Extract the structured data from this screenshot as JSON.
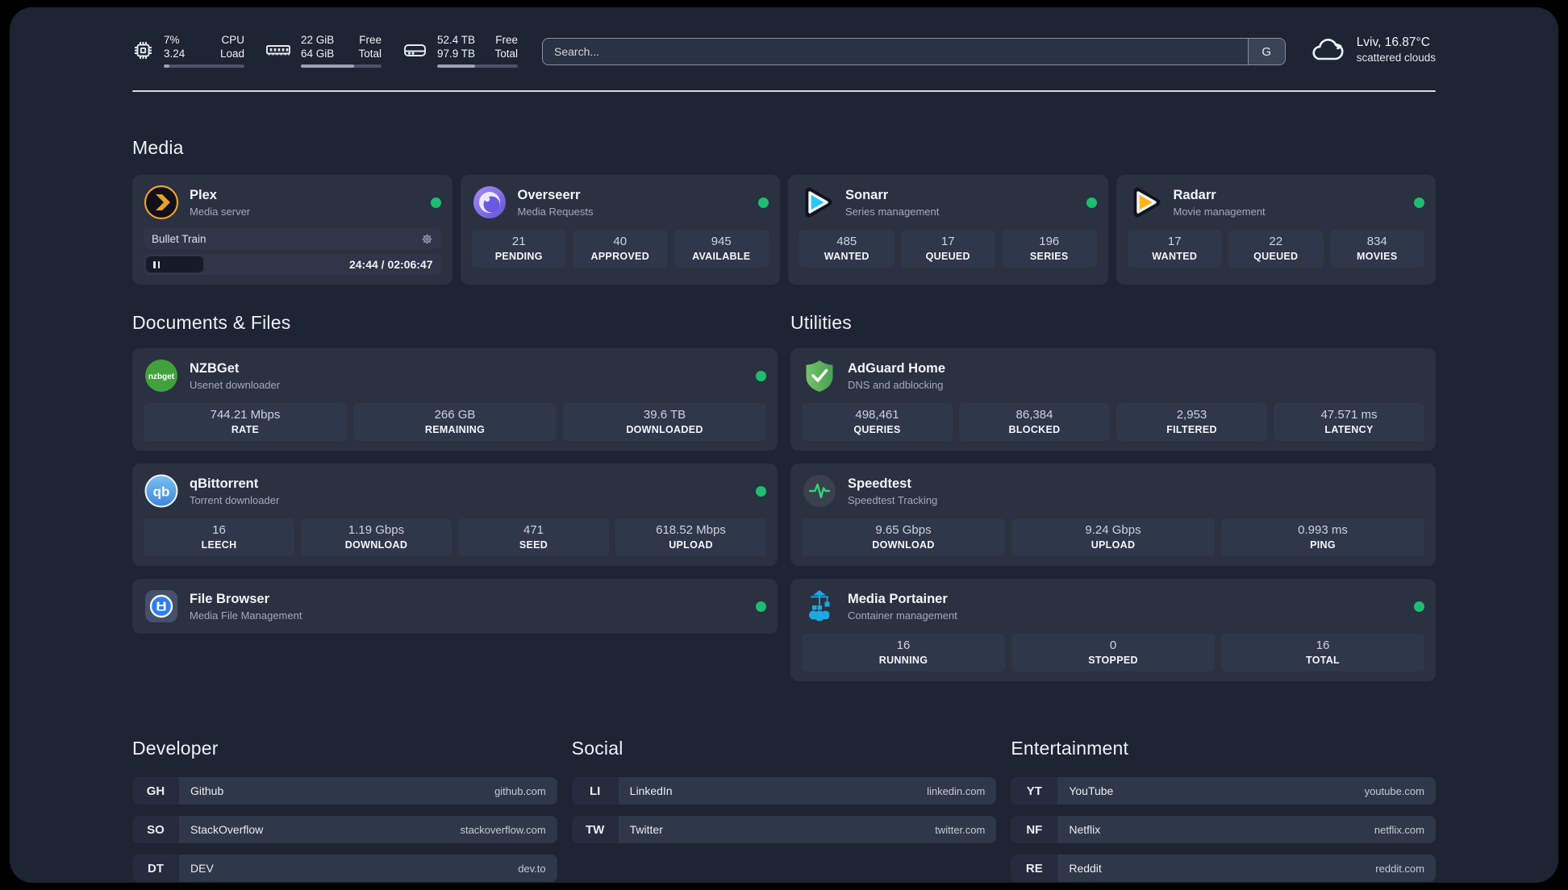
{
  "header": {
    "cpu": {
      "v1": "7%",
      "v2": "3.24",
      "l1": "CPU",
      "l2": "Load",
      "progress": 7
    },
    "ram": {
      "v1": "22 GiB",
      "v2": "64 GiB",
      "l1": "Free",
      "l2": "Total",
      "progress": 66
    },
    "disk": {
      "v1": "52.4 TB",
      "v2": "97.9 TB",
      "l1": "Free",
      "l2": "Total",
      "progress": 47
    },
    "search": {
      "placeholder": "Search...",
      "button": "G"
    },
    "weather": {
      "title": "Lviv, 16.87°C",
      "subtitle": "scattered clouds"
    }
  },
  "media": {
    "title": "Media",
    "plex": {
      "name": "Plex",
      "desc": "Media server",
      "now_playing": "Bullet Train",
      "time": "24:44 / 02:06:47",
      "progress": 20
    },
    "overseerr": {
      "name": "Overseerr",
      "desc": "Media Requests",
      "stats": [
        {
          "value": "21",
          "label": "PENDING"
        },
        {
          "value": "40",
          "label": "APPROVED"
        },
        {
          "value": "945",
          "label": "AVAILABLE"
        }
      ]
    },
    "sonarr": {
      "name": "Sonarr",
      "desc": "Series management",
      "stats": [
        {
          "value": "485",
          "label": "WANTED"
        },
        {
          "value": "17",
          "label": "QUEUED"
        },
        {
          "value": "196",
          "label": "SERIES"
        }
      ]
    },
    "radarr": {
      "name": "Radarr",
      "desc": "Movie management",
      "stats": [
        {
          "value": "17",
          "label": "WANTED"
        },
        {
          "value": "22",
          "label": "QUEUED"
        },
        {
          "value": "834",
          "label": "MOVIES"
        }
      ]
    }
  },
  "documents": {
    "title": "Documents & Files",
    "nzbget": {
      "name": "NZBGet",
      "desc": "Usenet downloader",
      "stats": [
        {
          "value": "744.21 Mbps",
          "label": "RATE"
        },
        {
          "value": "266 GB",
          "label": "REMAINING"
        },
        {
          "value": "39.6 TB",
          "label": "DOWNLOADED"
        }
      ]
    },
    "qbittorrent": {
      "name": "qBittorrent",
      "desc": "Torrent downloader",
      "stats": [
        {
          "value": "16",
          "label": "LEECH"
        },
        {
          "value": "1.19 Gbps",
          "label": "DOWNLOAD"
        },
        {
          "value": "471",
          "label": "SEED"
        },
        {
          "value": "618.52 Mbps",
          "label": "UPLOAD"
        }
      ]
    },
    "filebrowser": {
      "name": "File Browser",
      "desc": "Media File Management"
    }
  },
  "utilities": {
    "title": "Utilities",
    "adguard": {
      "name": "AdGuard Home",
      "desc": "DNS and adblocking",
      "stats": [
        {
          "value": "498,461",
          "label": "QUERIES"
        },
        {
          "value": "86,384",
          "label": "BLOCKED"
        },
        {
          "value": "2,953",
          "label": "FILTERED"
        },
        {
          "value": "47.571 ms",
          "label": "LATENCY"
        }
      ]
    },
    "speedtest": {
      "name": "Speedtest",
      "desc": "Speedtest Tracking",
      "stats": [
        {
          "value": "9.65 Gbps",
          "label": "DOWNLOAD"
        },
        {
          "value": "9.24 Gbps",
          "label": "UPLOAD"
        },
        {
          "value": "0.993 ms",
          "label": "PING"
        }
      ]
    },
    "portainer": {
      "name": "Media Portainer",
      "desc": "Container management",
      "stats": [
        {
          "value": "16",
          "label": "RUNNING"
        },
        {
          "value": "0",
          "label": "STOPPED"
        },
        {
          "value": "16",
          "label": "TOTAL"
        }
      ]
    }
  },
  "links": {
    "developer": {
      "title": "Developer",
      "items": [
        {
          "tag": "GH",
          "name": "Github",
          "url": "github.com"
        },
        {
          "tag": "SO",
          "name": "StackOverflow",
          "url": "stackoverflow.com"
        },
        {
          "tag": "DT",
          "name": "DEV",
          "url": "dev.to"
        }
      ]
    },
    "social": {
      "title": "Social",
      "items": [
        {
          "tag": "LI",
          "name": "LinkedIn",
          "url": "linkedin.com"
        },
        {
          "tag": "TW",
          "name": "Twitter",
          "url": "twitter.com"
        }
      ]
    },
    "entertainment": {
      "title": "Entertainment",
      "items": [
        {
          "tag": "YT",
          "name": "YouTube",
          "url": "youtube.com"
        },
        {
          "tag": "NF",
          "name": "Netflix",
          "url": "netflix.com"
        },
        {
          "tag": "RE",
          "name": "Reddit",
          "url": "reddit.com"
        }
      ]
    }
  },
  "colors": {
    "status_online": "#1ebd71",
    "plex_accent": "#e8a12b",
    "sonarr_accent": "#2bc6f4",
    "radarr_accent": "#fdb516",
    "portainer_accent": "#1ca8e3"
  }
}
